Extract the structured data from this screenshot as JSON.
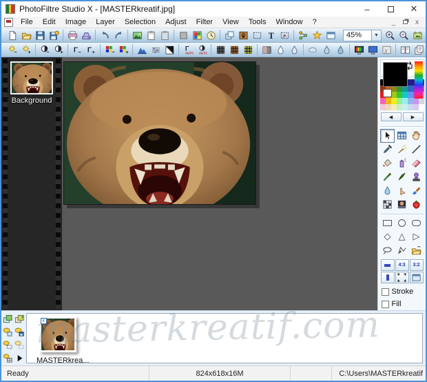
{
  "window": {
    "title": "PhotoFiltre Studio X - [MASTERkreatif.jpg]",
    "controls": [
      "minimize",
      "maximize",
      "close"
    ]
  },
  "menu": {
    "items": [
      "File",
      "Edit",
      "Image",
      "Layer",
      "Selection",
      "Adjust",
      "Filter",
      "View",
      "Tools",
      "Window",
      "?"
    ]
  },
  "toolbar_main": {
    "zoom_value": "45%",
    "icons": [
      "new",
      "open",
      "save",
      "save-all",
      "|",
      "print",
      "scan",
      "|",
      "undo",
      "redo",
      "|",
      "paste-as-image",
      "copy",
      "paste",
      "|",
      "hide-selection",
      "color-palette",
      "automation",
      "|",
      "duplicate-layer",
      "image-layer",
      "show-selection",
      "text",
      "paste-into-selection",
      "|",
      "explorer",
      "photomasque",
      "plugin-module",
      "#",
      "ZOOM",
      "zoom-in",
      "zoom-out",
      "fit-window"
    ]
  },
  "toolbar_adjust": {
    "icons": [
      "brightness-minus",
      "brightness-plus",
      "|",
      "contrast-minus",
      "contrast-plus",
      "|",
      "gamma-minus",
      "gamma-plus",
      "|",
      "saturation-minus",
      "saturation-plus",
      "|",
      "histogram",
      "levels",
      "negative",
      "|",
      "auto-levels",
      "auto-contrast",
      "|",
      "mosaic-small",
      "mosaic-medium",
      "mosaic-large",
      "|",
      "gradient",
      "sharpen",
      "sharpen-more",
      "|",
      "blur",
      "soften",
      "blur-more",
      "|",
      "rgb-balance",
      "monitor-gamma",
      "variations",
      "|",
      "side-pages",
      "stacked-pages"
    ]
  },
  "filmstrip": {
    "layer_label": "Background"
  },
  "right_panel": {
    "foreground_color": "#000000",
    "background_color": "#ffffff",
    "palette_colors": [
      "#000000",
      "#6b1500",
      "#3c5a14",
      "#1e641e",
      "#28326e",
      "#1e1e8c",
      "#50146e",
      "#3c3c3c",
      "#8c3214",
      "#c86414",
      "#8c8c14",
      "#329632",
      "#149696",
      "#3264c8",
      "#8c32c8",
      "#787878",
      "#e61e1e",
      "#f08214",
      "#a0c814",
      "#32c832",
      "#14c8c8",
      "#6496f0",
      "#e632e6",
      "#b4b4b4",
      "#f064b4",
      "#f0b414",
      "#f0f014",
      "#96f096",
      "#96f0f0",
      "#96b4f0",
      "#c896f0",
      "#d7d7d7",
      "#f0c8dc",
      "#f0dcb4",
      "#f0f0b4",
      "#c8f0c8",
      "#c8f0f0",
      "#c8dcf0",
      "#dcc8f0",
      "#ffffff"
    ],
    "palette_nav": [
      "left",
      "right"
    ],
    "tools": [
      "selection-arrow",
      "manager",
      "hand",
      "pipette",
      "magic-wand",
      "line",
      "fill",
      "spray",
      "eraser",
      "brush",
      "advanced-brush",
      "clone-stamp",
      "blur-tool",
      "smudge",
      "retouch",
      "deform",
      "nozzle",
      "red-eye"
    ],
    "selected_tool": "selection-arrow",
    "shapes": [
      "rectangle",
      "ellipse",
      "rounded-rectangle",
      "diamond",
      "triangle",
      "right-triangle",
      "lasso",
      "polygon",
      "load-selection"
    ],
    "mini_buttons": [
      "manual-size",
      "ratio-4-3",
      "ratio-3-2",
      "ratio-1-1",
      "expand-selection",
      "selection-options"
    ],
    "mini_labels": {
      "ratio43": "4:3",
      "ratio32": "3:2"
    },
    "stroke_label": "Stroke",
    "fill_label": "Fill",
    "stroke_checked": false,
    "fill_checked": false
  },
  "bottom_bar": {
    "icons": [
      "layer-new",
      "layer-duplicate",
      "select-ellipse",
      "save-selection",
      "paste-selection",
      "copy-selection",
      "grid-selection",
      "more-arrow"
    ],
    "thumb_label": "MASTERkrea...",
    "watermark": "masterkreatif.com"
  },
  "status": {
    "ready": "Ready",
    "dimensions": "824x618x16M",
    "path": "C:\\Users\\MASTERkreatif"
  }
}
